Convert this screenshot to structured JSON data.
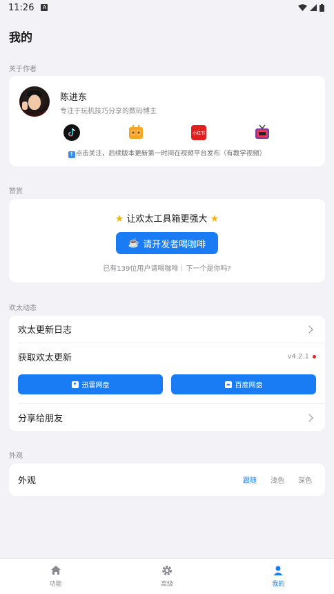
{
  "status_bar": {
    "time": "11:26",
    "notif_badge": "A"
  },
  "page_title": "我的",
  "about": {
    "section_label": "关于作者",
    "name": "陈进东",
    "desc": "专注于玩机技巧分享的数码博主",
    "platforms": [
      {
        "icon": "tiktok-icon",
        "label": ""
      },
      {
        "icon": "bilibili-icon",
        "label": ""
      },
      {
        "icon": "xiaohongshu-icon",
        "label": "小红书"
      },
      {
        "icon": "tv-icon",
        "label": ""
      }
    ],
    "follow_tip": "点击关注，后续版本更新第一时间在视频平台发布（有教学视频）"
  },
  "donate": {
    "section_label": "赞赏",
    "title": "让欢太工具箱更强大",
    "button_label": "请开发者喝咖啡",
    "stats_left": "已有139位用户请喝咖啡",
    "stats_right": "下一个是你吗?"
  },
  "news": {
    "section_label": "欢太动态",
    "changelog_label": "欢太更新日志",
    "get_update_label": "获取欢太更新",
    "version": "v4.2.1",
    "xunlei_label": "迅雷网盘",
    "baidu_label": "百度网盘",
    "share_label": "分享给朋友"
  },
  "appearance": {
    "section_label": "外观",
    "row_label": "外观",
    "options": [
      "跟随",
      "浅色",
      "深色"
    ],
    "selected": "跟随"
  },
  "bottom_nav": [
    {
      "label": "功能",
      "icon": "home-icon",
      "active": false
    },
    {
      "label": "高级",
      "icon": "gear-icon",
      "active": false
    },
    {
      "label": "我的",
      "icon": "person-icon",
      "active": true
    }
  ],
  "colors": {
    "accent": "#1a7cf5",
    "background": "#f2f2f7",
    "badge_red": "#e0262a"
  }
}
